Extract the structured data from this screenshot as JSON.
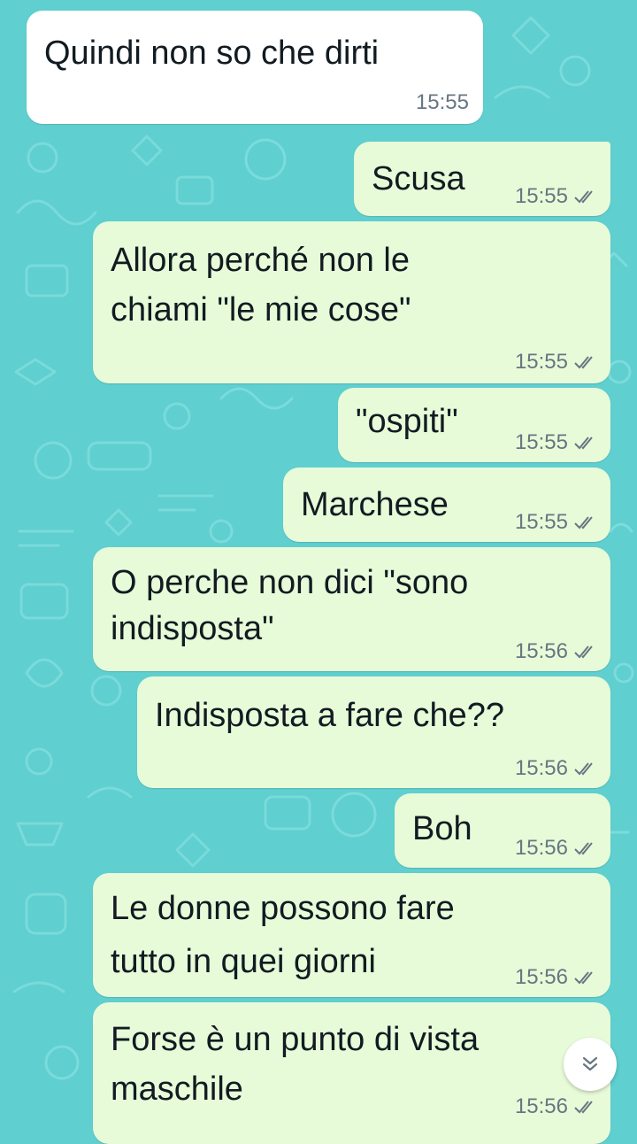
{
  "colors": {
    "wallpaper": "#5fcfcf",
    "incoming_bubble": "#ffffff",
    "outgoing_bubble": "#e8fbd9",
    "text": "#111b21",
    "meta": "#667781"
  },
  "messages": [
    {
      "direction": "in",
      "text": "Quindi non so che dirti",
      "time": "15:55"
    },
    {
      "direction": "out",
      "text": "Scusa",
      "time": "15:55",
      "ticks": "double-check-icon"
    },
    {
      "direction": "out",
      "text_lines": [
        "Allora perché non le",
        "chiami \"le mie cose\""
      ],
      "time": "15:55",
      "ticks": "double-check-icon"
    },
    {
      "direction": "out",
      "text": "\"ospiti\"",
      "time": "15:55",
      "ticks": "double-check-icon"
    },
    {
      "direction": "out",
      "text": "Marchese",
      "time": "15:55",
      "ticks": "double-check-icon"
    },
    {
      "direction": "out",
      "text_lines": [
        "O perche non dici \"sono",
        "indisposta\""
      ],
      "time": "15:56",
      "ticks": "double-check-icon"
    },
    {
      "direction": "out",
      "text": "Indisposta a fare che??",
      "time": "15:56",
      "ticks": "double-check-icon"
    },
    {
      "direction": "out",
      "text": "Boh",
      "time": "15:56",
      "ticks": "double-check-icon"
    },
    {
      "direction": "out",
      "text_lines": [
        "Le donne possono fare",
        "tutto in quei giorni"
      ],
      "time": "15:56",
      "ticks": "double-check-icon"
    },
    {
      "direction": "out",
      "text_lines": [
        "Forse è un punto di vista",
        "maschile"
      ],
      "time": "15:56",
      "ticks": "double-check-icon"
    }
  ],
  "scroll_button": {
    "icon": "double-chevron-down-icon"
  }
}
